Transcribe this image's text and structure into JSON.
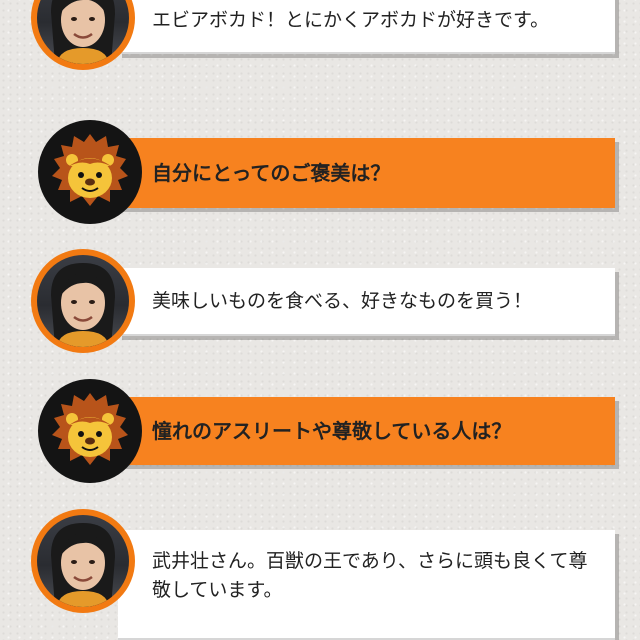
{
  "qa": [
    {
      "type": "answer",
      "text": "エビアボカド！とにかくアボカドが好きです。",
      "avatar": "person-avatar"
    },
    {
      "type": "question",
      "text": "自分にとってのご褒美は？",
      "avatar": "lion-mascot-icon"
    },
    {
      "type": "answer",
      "text": "美味しいものを食べる、好きなものを買う！",
      "avatar": "person-avatar"
    },
    {
      "type": "question",
      "text": "憧れのアスリートや尊敬している人は？",
      "avatar": "lion-mascot-icon"
    },
    {
      "type": "answer",
      "text": "武井壮さん。百獣の王であり、さらに頭も良くて尊敬しています。",
      "avatar": "person-avatar"
    }
  ],
  "colors": {
    "accent": "#f7821f",
    "avatar_ring": "#f27a12",
    "lion_bg": "#141414",
    "answer_bg": "#ffffff"
  }
}
